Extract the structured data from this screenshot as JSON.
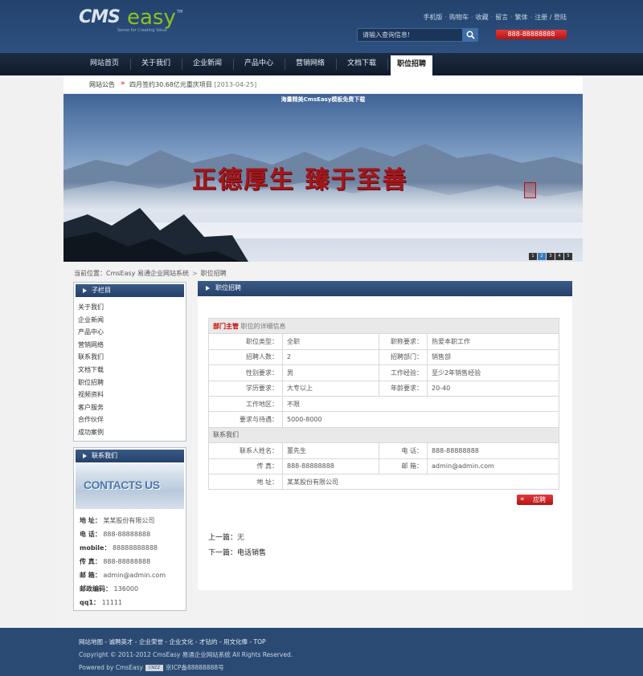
{
  "header": {
    "logo_cms": "CMS",
    "logo_easy": "easy",
    "logo_tm": "TM",
    "logo_slogan": "Sense for Creating Value",
    "top_links": [
      "手机版",
      "购物车",
      "收藏",
      "留言",
      "繁体",
      "注册 / 登陆"
    ],
    "separator": "·",
    "search_placeholder": "请输入查询信息!",
    "hotline": "888-88888888"
  },
  "nav": {
    "items": [
      "网站首页",
      "关于我们",
      "企业新闻",
      "产品中心",
      "营销网络",
      "文档下载",
      "职位招聘"
    ],
    "active_index": 6
  },
  "notice": {
    "label": "网站公告",
    "arrow": "»",
    "text": "四月签约30.68亿元重庆项目",
    "date": "[2013-04-25]"
  },
  "banner": {
    "caption": "海量精美CmsEasy模板免费下载",
    "calligraphy": "正德厚生  臻于至善",
    "dots": [
      "1",
      "2",
      "3",
      "4",
      "5"
    ],
    "active_dot": 1
  },
  "breadcrumb": {
    "label": "当前位置：",
    "sep": ">",
    "items": [
      "CmsEasy 易通企业网站系统",
      "职位招聘"
    ]
  },
  "sidebar": {
    "subnav_title": "子栏目",
    "subnav_items": [
      "关于我们",
      "企业新闻",
      "产品中心",
      "营销网络",
      "联系我们",
      "文档下载",
      "职位招聘",
      "视频资料",
      "客户服务",
      "合作伙伴",
      "成功案例"
    ],
    "contact_title": "联系我们",
    "contact_image_text": "CONTACTS US",
    "contact_items": [
      {
        "label": "地 址：",
        "value": "某某股份有限公司"
      },
      {
        "label": "电 话：",
        "value": "888-88888888"
      },
      {
        "label": "mobile：",
        "value": "88888888888"
      },
      {
        "label": "传 真：",
        "value": "888-88888888"
      },
      {
        "label": "邮 箱：",
        "value": "admin@admin.com"
      },
      {
        "label": "邮政编码：",
        "value": "136000"
      },
      {
        "label": "qq1：",
        "value": "11111"
      }
    ]
  },
  "main": {
    "title": "职位招聘",
    "dept": "部门主管",
    "dept_sub": "职位的详细信息",
    "rows": [
      {
        "l1": "职位类型：",
        "v1": "全职",
        "l2": "职称要求：",
        "v2": "热爱本职工作"
      },
      {
        "l1": "招聘人数：",
        "v1": "2",
        "l2": "招聘部门：",
        "v2": "销售部"
      },
      {
        "l1": "性别要求：",
        "v1": "男",
        "l2": "工作经验：",
        "v2": "至少2年销售经验"
      },
      {
        "l1": "学历要求：",
        "v1": "大专以上",
        "l2": "年龄要求：",
        "v2": "20-40"
      }
    ],
    "location_label": "工作地区：",
    "location_value": "不限",
    "salary_label": "要求与待遇：",
    "salary_value": "5000-8000",
    "contact_section": "联系我们",
    "contact_rows": [
      {
        "l1": "联系人姓名：",
        "v1": "董先生",
        "l2": "电 话：",
        "v2": "888-88888888"
      },
      {
        "l1": "传 真：",
        "v1": "888-88888888",
        "l2": "邮 箱：",
        "v2": "admin@admin.com"
      }
    ],
    "address_label": "地 址：",
    "address_value": "某某股份有限公司",
    "apply_arrow": "«",
    "apply_label": "应聘",
    "prev_label": "上一篇：",
    "prev_value": "无",
    "next_label": "下一篇：",
    "next_value": "电话销售"
  },
  "footer": {
    "links": [
      "网站地图",
      "诚聘英才",
      "企业荣誉",
      "企业文化",
      "才钻的",
      "用文化俸",
      "TOP"
    ],
    "link_sep": "-",
    "copyright": "Copyright © 2011-2012 CmsEasy 易通企业网站系统 All Rights Reserved.",
    "powered_prefix": "Powered by CmsEasy",
    "badge": "CNZZ",
    "icp": "京ICP备88888888号"
  }
}
